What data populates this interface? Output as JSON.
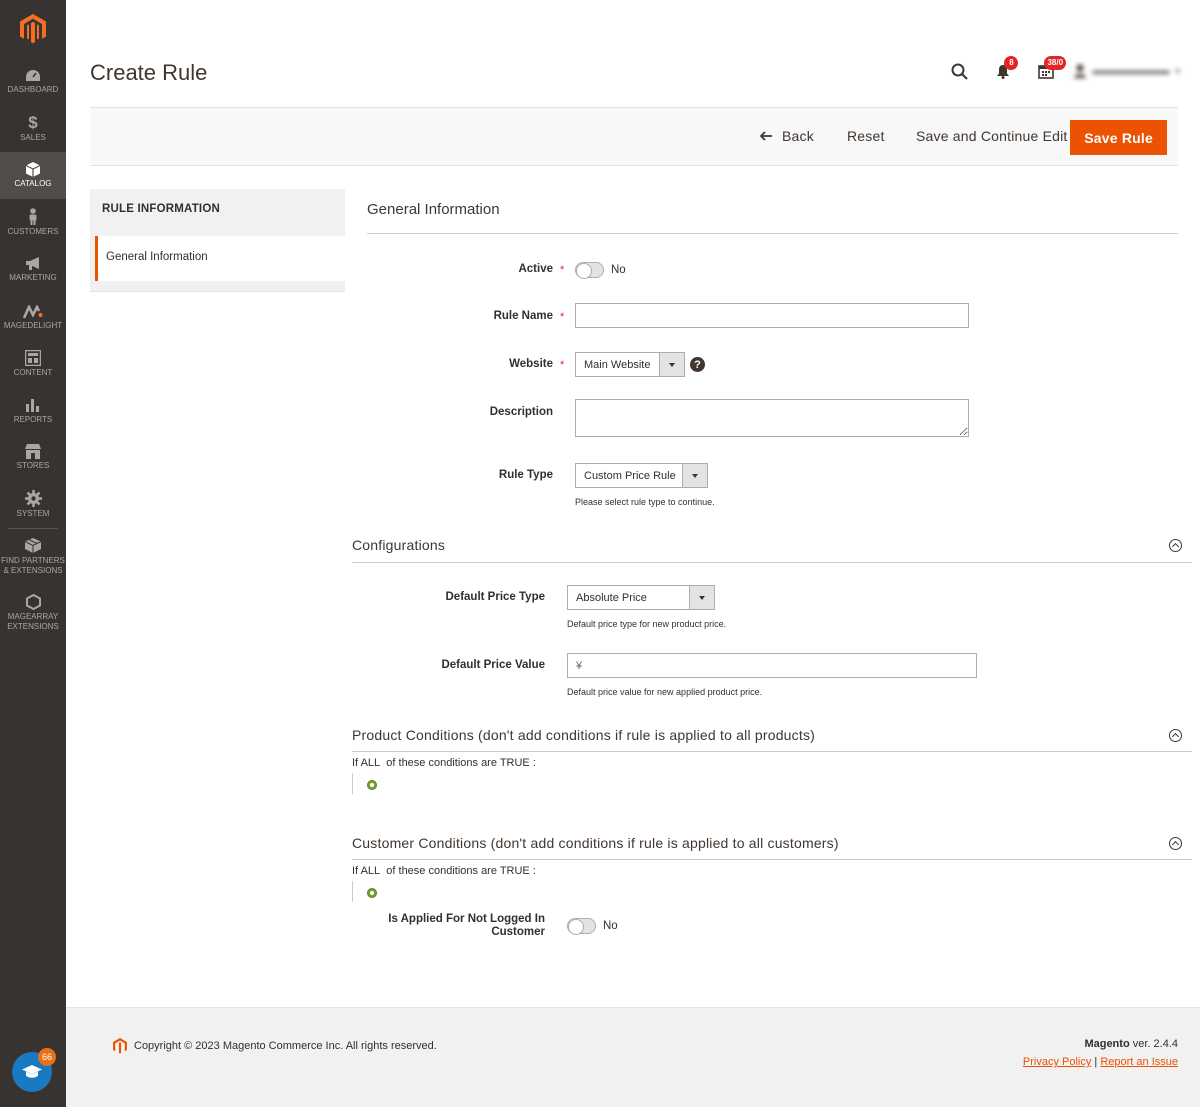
{
  "sidebar": {
    "logo": "magento-logo",
    "items": [
      {
        "label": "DASHBOARD",
        "icon": "dashboard-icon"
      },
      {
        "label": "SALES",
        "icon": "dollar-icon"
      },
      {
        "label": "CATALOG",
        "icon": "cube-icon",
        "active": true
      },
      {
        "label": "CUSTOMERS",
        "icon": "person-icon"
      },
      {
        "label": "MARKETING",
        "icon": "megaphone-icon"
      },
      {
        "label": "MAGEDELIGHT",
        "icon": "magedelight-icon"
      },
      {
        "label": "CONTENT",
        "icon": "layout-icon"
      },
      {
        "label": "REPORTS",
        "icon": "bar-chart-icon"
      },
      {
        "label": "STORES",
        "icon": "store-icon"
      },
      {
        "label": "SYSTEM",
        "icon": "gear-icon"
      },
      {
        "label": "FIND PARTNERS & EXTENSIONS",
        "icon": "boxes-icon"
      },
      {
        "label": "MAGEARRAY EXTENSIONS",
        "icon": "hexagon-icon"
      }
    ],
    "help_count": "66"
  },
  "header": {
    "title": "Create Rule",
    "notifications_count": "8",
    "system_messages_count": "38/0"
  },
  "actions": {
    "back": "Back",
    "reset": "Reset",
    "save_continue": "Save and Continue Edit",
    "save": "Save Rule"
  },
  "tabs": {
    "title": "RULE INFORMATION",
    "items": [
      {
        "label": "General Information"
      }
    ]
  },
  "general": {
    "title": "General Information",
    "active_label": "Active",
    "active_value": "No",
    "rule_name_label": "Rule Name",
    "rule_name_value": "",
    "website_label": "Website",
    "website_value": "Main Website",
    "description_label": "Description",
    "rule_type_label": "Rule Type",
    "rule_type_value": "Custom Price Rule",
    "rule_type_note": "Please select rule type to continue."
  },
  "configurations": {
    "title": "Configurations",
    "price_type_label": "Default Price Type",
    "price_type_value": "Absolute Price",
    "price_type_note": "Default price type for new product price.",
    "price_value_label": "Default Price Value",
    "price_value_placeholder": "¥",
    "price_value_note": "Default price value for new applied product price."
  },
  "product_conditions": {
    "title": "Product Conditions (don't add conditions if rule is applied to all products)",
    "if": "If",
    "aggregator": "ALL",
    "middle": "of these conditions are",
    "value": "TRUE",
    "colon": ":"
  },
  "customer_conditions": {
    "title": "Customer Conditions (don't add conditions if rule is applied to all customers)",
    "if": "If",
    "aggregator": "ALL",
    "middle": "of these conditions are",
    "value": "TRUE",
    "colon": ":",
    "not_logged_label_1": "Is Applied For Not Logged In",
    "not_logged_label_2": "Customer",
    "not_logged_value": "No"
  },
  "footer": {
    "copyright": "Copyright © 2023 Magento Commerce Inc. All rights reserved.",
    "brand": "Magento",
    "version": "ver. 2.4.4",
    "privacy": "Privacy Policy",
    "separator": "|",
    "report": "Report an Issue"
  },
  "colors": {
    "accent": "#eb5202",
    "sidebar": "#373330",
    "sidebar_active": "#524d49"
  }
}
